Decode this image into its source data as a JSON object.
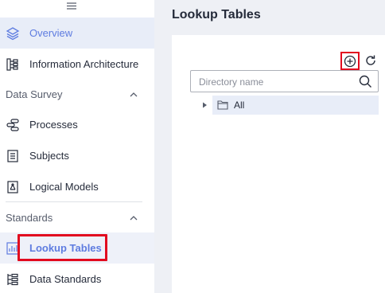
{
  "sidebar": {
    "items": [
      {
        "label": "Overview",
        "icon": "layers-icon"
      },
      {
        "label": "Information Architecture",
        "icon": "hierarchy-icon"
      },
      {
        "label": "Processes",
        "icon": "flow-icon"
      },
      {
        "label": "Subjects",
        "icon": "subject-icon"
      },
      {
        "label": "Logical Models",
        "icon": "model-icon"
      },
      {
        "label": "Lookup Tables",
        "icon": "chart-icon"
      },
      {
        "label": "Data Standards",
        "icon": "standards-icon"
      }
    ],
    "sections": [
      {
        "label": "Data Survey"
      },
      {
        "label": "Standards"
      }
    ]
  },
  "main": {
    "title": "Lookup Tables",
    "search": {
      "placeholder": "Directory name",
      "value": ""
    },
    "tree": [
      {
        "label": "All",
        "icon": "folder-icon"
      }
    ]
  },
  "colors": {
    "accent": "#5e7ce0",
    "highlight": "#e20b1f",
    "background": "#eef0f5"
  }
}
